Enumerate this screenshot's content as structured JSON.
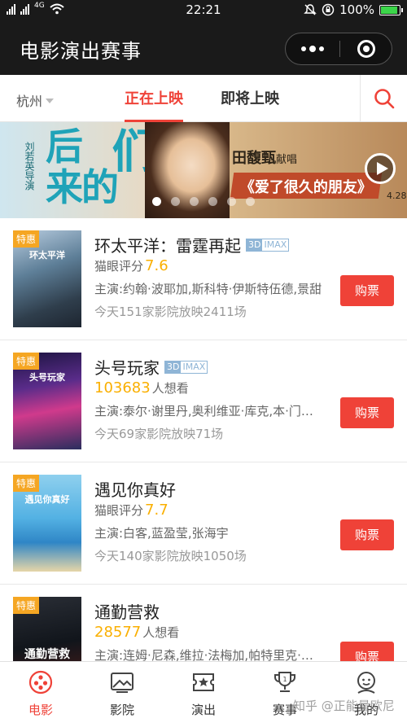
{
  "statusbar": {
    "left_network": "4G",
    "time": "22:21",
    "battery": "100%",
    "icons": [
      "signal-icon",
      "signal-icon",
      "wifi-icon",
      "silent-icon",
      "rotation-lock-icon",
      "battery-icon"
    ]
  },
  "titlebar": {
    "title": "电影演出赛事",
    "more_icon": "more-dots-icon",
    "close_icon": "miniapp-close-icon"
  },
  "nav": {
    "city": "杭州",
    "tabs": [
      {
        "label": "正在上映",
        "active": true
      },
      {
        "label": "即将上映",
        "active": false
      }
    ],
    "search_icon": "search-icon"
  },
  "banner": {
    "credit": "刘若英导演",
    "poster_line1": "后",
    "poster_line2": "来的",
    "poster_big": "我们",
    "singer": "田馥甄",
    "singer_suffix": "献唱",
    "song": "《爱了很久的朋友》",
    "date": "4.28",
    "dots_total": 6,
    "dots_active": 0
  },
  "movies": [
    {
      "tag": "特惠",
      "poster_text": "环太平洋",
      "title": "环太平洋：雷霆再起",
      "formats": [
        "3D",
        "IMAX"
      ],
      "metric_label": "猫眼评分",
      "metric_value": "7.6",
      "metric_type": "score",
      "cast": "主演:约翰·波耶加,斯科特·伊斯特伍德,景甜",
      "shows": "今天151家影院放映2411场",
      "buy": "购票"
    },
    {
      "tag": "特惠",
      "poster_text": "头号玩家",
      "title": "头号玩家",
      "formats": [
        "3D",
        "IMAX"
      ],
      "metric_label": "人想看",
      "metric_value": "103683",
      "metric_type": "want",
      "cast": "主演:泰尔·谢里丹,奥利维亚·库克,本·门德尔森",
      "shows": "今天69家影院放映71场",
      "buy": "购票"
    },
    {
      "tag": "特惠",
      "poster_text": "遇见你真好",
      "title": "遇见你真好",
      "formats": [],
      "metric_label": "猫眼评分",
      "metric_value": "7.7",
      "metric_type": "score",
      "cast": "主演:白客,蓝盈莹,张海宇",
      "shows": "今天140家影院放映1050场",
      "buy": "购票"
    },
    {
      "tag": "特惠",
      "poster_text": "通勤营救",
      "title": "通勤营救",
      "formats": [],
      "metric_label": "人想看",
      "metric_value": "28577",
      "metric_type": "want",
      "cast": "主演:连姆·尼森,维拉·法梅加,帕特里克·威尔森",
      "shows": "",
      "buy": "购票"
    }
  ],
  "tabbar": [
    {
      "label": "电影",
      "icon": "film-reel-icon",
      "active": true
    },
    {
      "label": "影院",
      "icon": "cinema-icon",
      "active": false
    },
    {
      "label": "演出",
      "icon": "ticket-star-icon",
      "active": false
    },
    {
      "label": "赛事",
      "icon": "trophy-icon",
      "active": false
    },
    {
      "label": "我的",
      "icon": "profile-face-icon",
      "active": false
    }
  ],
  "watermark": "知乎 @正能量欧尼",
  "colors": {
    "accent": "#ef4238",
    "score": "#faaf00",
    "tag": "#f5a623",
    "format": "#8fb5d6",
    "header": "#1a1a1a"
  }
}
